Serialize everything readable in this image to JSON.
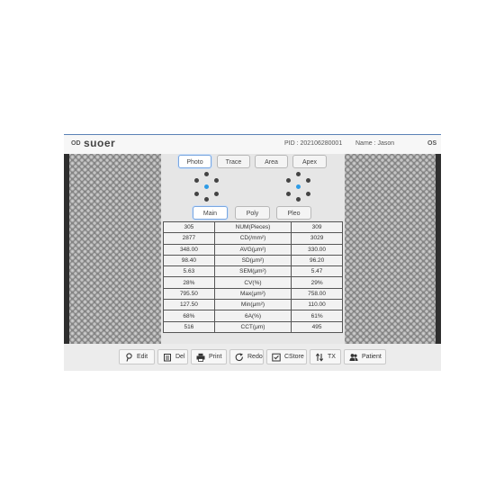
{
  "header": {
    "eye_od": "OD",
    "logo": "suoer",
    "pid": "PID : 202106280001",
    "name": "Name : Jason",
    "eye_os": "OS"
  },
  "mode_tabs": [
    "Photo",
    "Trace",
    "Area",
    "Apex"
  ],
  "mode_tabs_active": "Photo",
  "view_tabs": [
    "Main",
    "Poly",
    "Pleo"
  ],
  "view_tabs_active": "Main",
  "table": {
    "rows": [
      {
        "left": "305",
        "label": "NUM(Pieces)",
        "right": "309"
      },
      {
        "left": "2877",
        "label": "CD(/mm²)",
        "right": "3029"
      },
      {
        "left": "348.00",
        "label": "AVG(μm²)",
        "right": "330.00"
      },
      {
        "left": "98.40",
        "label": "SD(μm²)",
        "right": "96.20"
      },
      {
        "left": "5.63",
        "label": "SEM(μm²)",
        "right": "5.47"
      },
      {
        "left": "28%",
        "label": "CV(%)",
        "right": "29%"
      },
      {
        "left": "795.50",
        "label": "Max(μm²)",
        "right": "758.00"
      },
      {
        "left": "127.50",
        "label": "Min(μm²)",
        "right": "110.00"
      },
      {
        "left": "68%",
        "label": "6A(%)",
        "right": "61%"
      },
      {
        "left": "516",
        "label": "CCT(μm)",
        "right": "495"
      }
    ]
  },
  "toolbar": {
    "edit": "Edit",
    "del": "Del",
    "print": "Print",
    "redo": "Redo",
    "cstore": "CStore",
    "tx": "TX",
    "patient": "Patient"
  },
  "colors": {
    "accent": "#2d9be6",
    "title_border": "#5b82b6",
    "active_border": "#7aa7e0"
  }
}
